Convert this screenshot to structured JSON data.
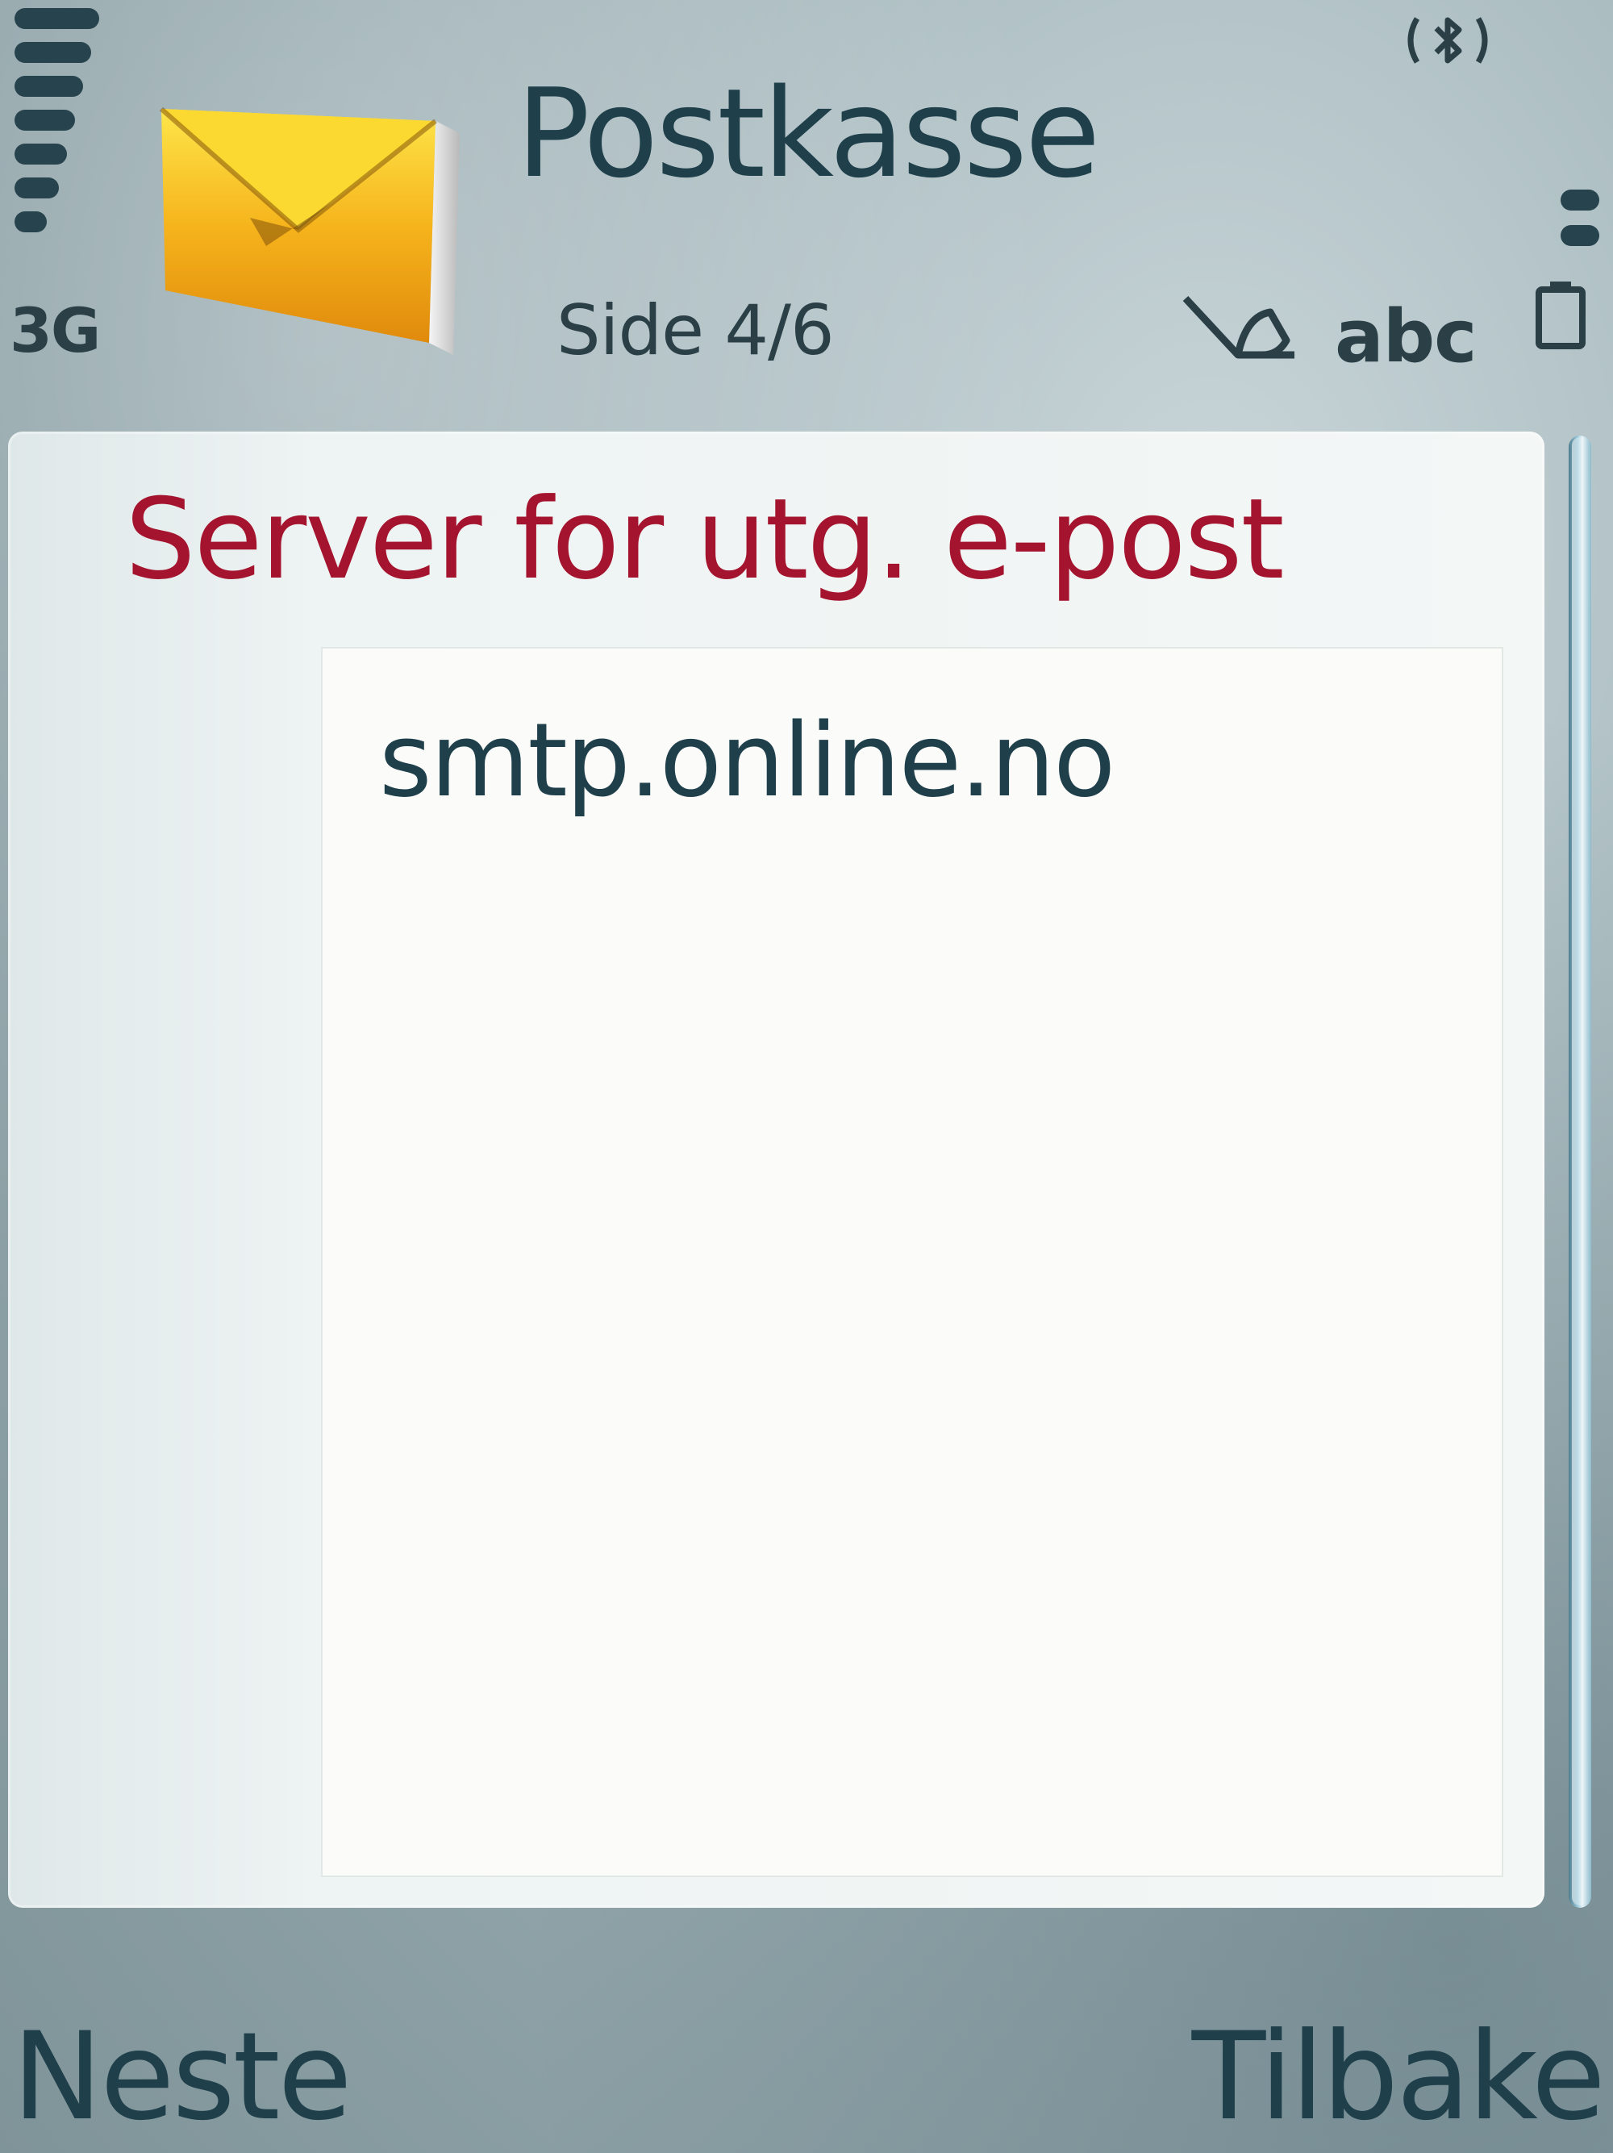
{
  "status": {
    "network_type": "3G",
    "text_mode": "abc",
    "signal_level_bars": 7
  },
  "header": {
    "title": "Postkasse",
    "page_indicator": "Side 4/6",
    "icon": "envelope-icon"
  },
  "form": {
    "field_label": "Server for utg. e-post",
    "field_value": "smtp.online.no"
  },
  "softkeys": {
    "left": "Neste",
    "right": "Tilbake"
  },
  "colors": {
    "label_red": "#a5142e",
    "text_dark": "#1f3f4b",
    "envelope_yellow": "#f6c21a"
  }
}
